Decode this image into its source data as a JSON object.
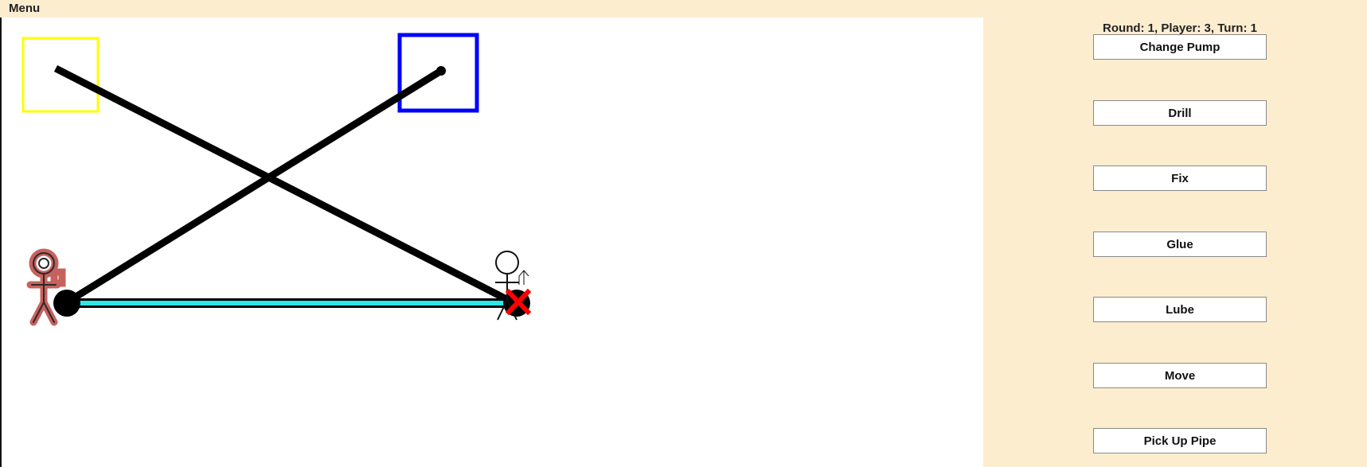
{
  "menu": {
    "label": "Menu"
  },
  "status": {
    "text": "Round: 1, Player: 3, Turn: 1"
  },
  "actions": [
    {
      "label": "Change Pump"
    },
    {
      "label": "Drill"
    },
    {
      "label": "Fix"
    },
    {
      "label": "Glue"
    },
    {
      "label": "Lube"
    },
    {
      "label": "Move"
    },
    {
      "label": "Pick Up Pipe"
    }
  ],
  "board": {
    "source_box_color": "#ffff00",
    "cistern_box_color": "#0000ff",
    "pipe_color": "#000000",
    "water_pipe_color": "#2ee8e8",
    "broken_marker_color": "#ff0000",
    "active_player_color": "#c0504d",
    "icons": [
      "stick-figure-player",
      "stick-figure-player",
      "broken-pump-x"
    ]
  }
}
